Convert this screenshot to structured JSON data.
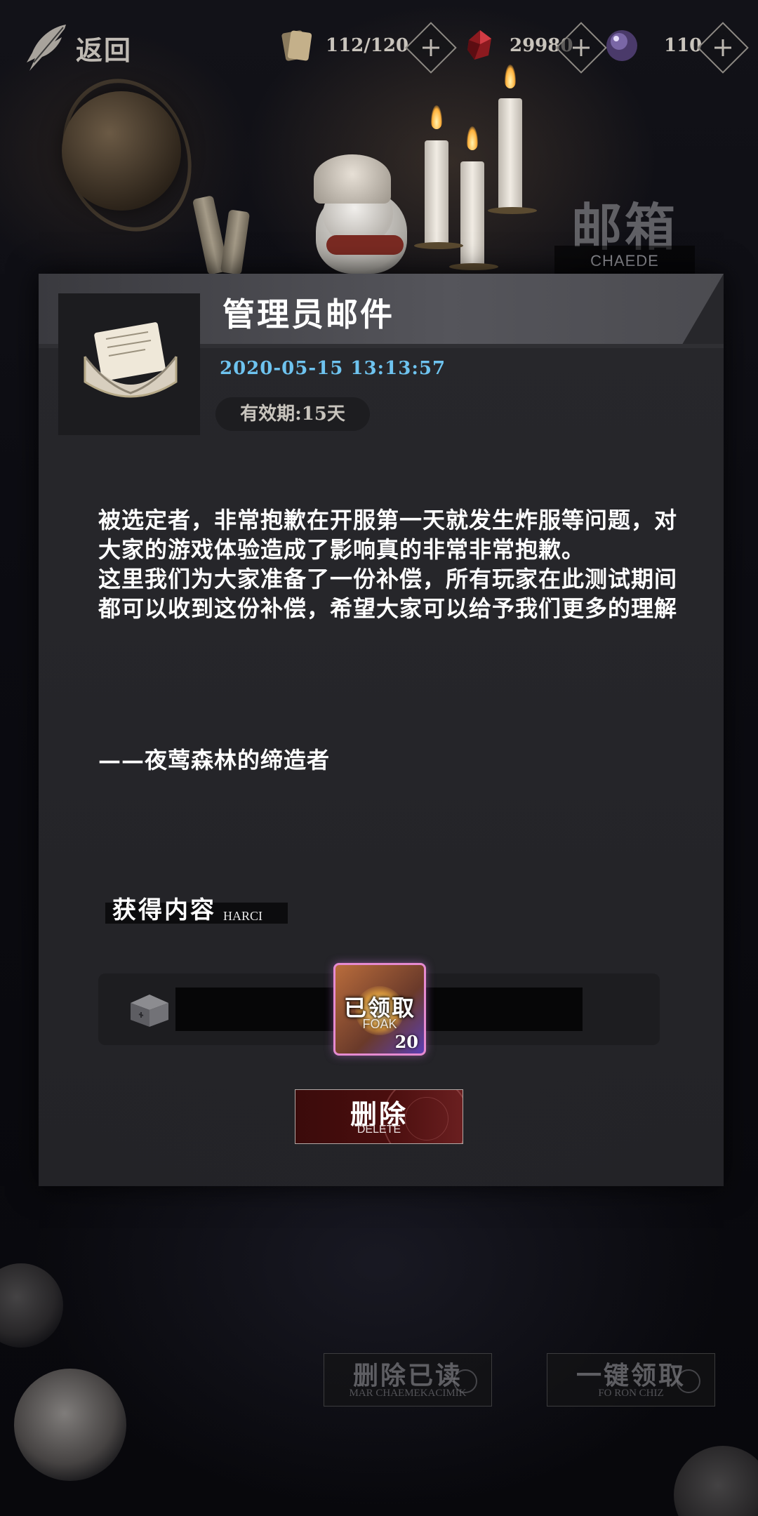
{
  "topbar": {
    "back_label": "返回",
    "resources": [
      {
        "icon": "cards-icon",
        "value": "112/120"
      },
      {
        "icon": "ruby-gem-icon",
        "value": "29980"
      },
      {
        "icon": "crystal-orb-icon",
        "value": "110"
      }
    ]
  },
  "page_title": {
    "zh": "邮箱",
    "en": "CHAEDE"
  },
  "mail": {
    "title": "管理员邮件",
    "date": "2020-05-15  13:13:57",
    "validity": "有效期:15天",
    "body": [
      "被选定者，非常抱歉在开服第一天就发生炸服等问题，对大家的游戏体验造成了影响真的非常非常抱歉。",
      "这里我们为大家准备了一份补偿，所有玩家在此测试期间都可以收到这份补偿，希望大家可以给予我们更多的理解"
    ],
    "signature": "——夜莺森林的缔造者"
  },
  "rewards": {
    "label_zh": "获得内容",
    "label_en": "HARCI",
    "item": {
      "status_zh": "已领取",
      "status_en": "FOAK",
      "quantity": "20"
    }
  },
  "delete_button": {
    "zh": "删除",
    "en": "DELETE"
  },
  "bottom_buttons": {
    "delete_read": {
      "zh": "删除已读",
      "en": "MAR CHAEMEKACIMIK"
    },
    "claim_all": {
      "zh": "一键领取",
      "en": "FO RON CHIZ"
    }
  },
  "colors": {
    "date": "#6ec3ef",
    "delete_button_bg": "#4a0e0e",
    "reward_border": "#e58ad0"
  }
}
